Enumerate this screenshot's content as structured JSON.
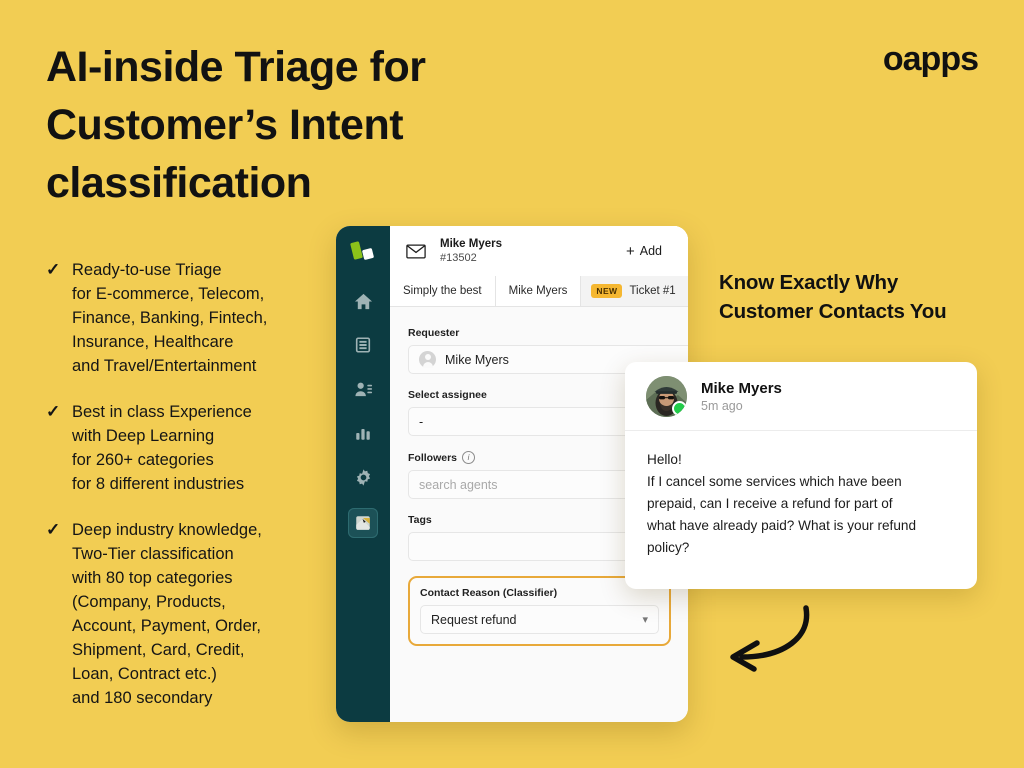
{
  "brand": {
    "logo_text": "oapps",
    "bg_color": "#f2cd53",
    "accent_color": "#e8a93a",
    "sidebar_color": "#0c3b41"
  },
  "headline": {
    "line1": "AI-inside Triage for",
    "line2": "Customer’s Intent",
    "line3": "classification"
  },
  "bullets": [
    {
      "check": "✓",
      "lines": [
        "Ready-to-use Triage",
        "for E-commerce, Telecom,",
        "Finance, Banking, Fintech,",
        "Insurance, Healthcare",
        "and Travel/Entertainment"
      ]
    },
    {
      "check": "✓",
      "lines": [
        "Best in class Experience",
        "with Deep Learning",
        "for 260+ categories",
        "for 8 different industries"
      ]
    },
    {
      "check": "✓",
      "lines": [
        "Deep industry knowledge,",
        "Two-Tier classification",
        "with 80 top categories",
        "(Company, Products,",
        "Account, Payment, Order,",
        "Shipment, Card, Credit,",
        "Loan, Contract etc.)",
        "and 180 secondary"
      ]
    }
  ],
  "right_heading": {
    "line1": "Know Exactly Why",
    "line2": "Customer Contacts You"
  },
  "app": {
    "sidebar": {
      "items": [
        {
          "icon": "oapps-logo-icon",
          "label": ""
        },
        {
          "icon": "home-icon",
          "label": "Home"
        },
        {
          "icon": "tickets-icon",
          "label": "Tickets"
        },
        {
          "icon": "contacts-icon",
          "label": "Contacts"
        },
        {
          "icon": "chart-bar-icon",
          "label": "Reports"
        },
        {
          "icon": "gear-icon",
          "label": "Settings"
        },
        {
          "icon": "app-tile-icon",
          "label": "Apps"
        }
      ]
    },
    "header": {
      "mail_icon": "envelope-icon",
      "requester_name": "Mike Myers",
      "ticket_id": "#13502",
      "status_dot_color": "#1566c6",
      "close_label": "×",
      "add_plus": "+",
      "add_label": "Add"
    },
    "tabs": [
      {
        "label": "Simply the best",
        "badge": ""
      },
      {
        "label": "Mike Myers",
        "badge": ""
      },
      {
        "label": "Ticket #1",
        "badge": "NEW"
      }
    ],
    "form": {
      "requester_label": "Requester",
      "requester_value": "Mike Myers",
      "assignee_label": "Select assignee",
      "assignee_value": "-",
      "followers_label": "Followers",
      "followers_info_icon": "info-icon",
      "followers_placeholder": "search agents",
      "tags_label": "Tags",
      "tags_value": "",
      "classifier_label": "Contact Reason (Classifier)",
      "classifier_value": "Request refund",
      "classifier_chevron": "chevron-down-icon"
    }
  },
  "message_card": {
    "avatar": "user-photo-avatar",
    "online_status_color": "#22cc4a",
    "name": "Mike Myers",
    "time": "5m ago",
    "body_lines": [
      "Hello!",
      "If I cancel some services which have been",
      "prepaid, can I receive a refund for part of",
      "what have already paid? What is your refund",
      "policy?"
    ]
  },
  "arrow": {
    "icon": "curved-arrow-icon"
  }
}
